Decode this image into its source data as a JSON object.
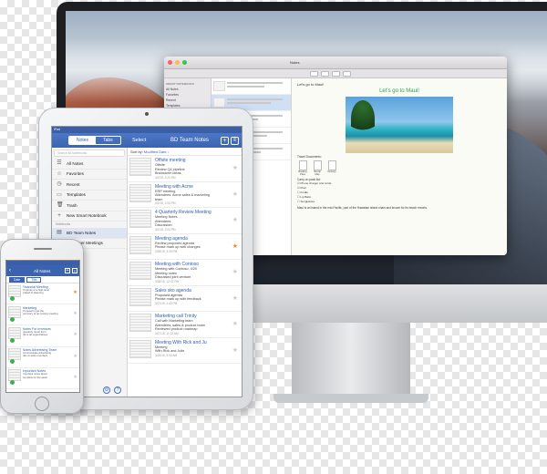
{
  "mac": {
    "window_title": "Notes",
    "sidebar": {
      "header_smart": "SMART NOTEBOOKS",
      "items": [
        "All Notes",
        "Favorites",
        "Recent",
        "Templates",
        "Trash"
      ],
      "header_notebooks": "NOTEBOOKS",
      "notebooks": [
        "Work",
        "Personal"
      ]
    },
    "note": {
      "subject": "Let's go to Maui!",
      "title": "Let's go to Maui!",
      "travel_label": "Travel Documents:",
      "docs": [
        "Booking Pass",
        "Rental Map",
        "Itinerary"
      ],
      "checklist_title": "Carry-on pack list:",
      "checklist": [
        "Phone charger and cords",
        "iPad",
        "Kindle",
        "Lip Balm",
        "Sunglasses"
      ],
      "footer": "Maui is an island in the mid-Pacific, part of the Hawaiian island chain and known for its beach resorts."
    }
  },
  "ipad": {
    "status_left": "iPad",
    "segment": [
      "Notes",
      "Tabs"
    ],
    "select_label": "Select",
    "notebook_title": "BD Team Notes",
    "plus_label": "+",
    "menu_label": "≡",
    "search_placeholder": "Search all Notebooks",
    "sidebar_items": [
      {
        "icon": "☰",
        "icon_name": "all-notes-icon",
        "label": "All Notes"
      },
      {
        "icon": "☆",
        "icon_name": "favorites-icon",
        "label": "Favorites"
      },
      {
        "icon": "◷",
        "icon_name": "recent-icon",
        "label": "Recent"
      },
      {
        "icon": "▭",
        "icon_name": "templates-icon",
        "label": "Templates"
      },
      {
        "icon": "🗑",
        "icon_name": "trash-icon",
        "label": "Trash"
      },
      {
        "icon": "+",
        "icon_name": "add-icon",
        "label": "New Smart Notebook"
      }
    ],
    "notebooks_header": "Notebooks",
    "notebooks": [
      {
        "label": "BD Team Notes",
        "selected": true
      },
      {
        "label": "Customer Meetings",
        "selected": false
      }
    ],
    "sort_label": "Sort by:",
    "sort_value": "Modified Date ↓",
    "notes": [
      {
        "title": "Offsite meeting",
        "lines": [
          "Offsite",
          "Review Q4 pipeline",
          "Brainstorm ideas"
        ],
        "date": "4/2/15, 2:20 PM",
        "starred": false
      },
      {
        "title": "Meeting with Acme",
        "lines": [
          "ERP meeting",
          "Attendees: Acme sales & marketing",
          "team"
        ],
        "date": "4/2/15, 1:53 PM",
        "starred": false
      },
      {
        "title": "4 Quarterly Review Meeting",
        "lines": [
          "Meeting Notes",
          "Attendees:",
          "Discussion:"
        ],
        "date": "4/2/15, 2:00 PM",
        "starred": false
      },
      {
        "title": "Meeting agenda",
        "lines": [
          "Review proposed agenda",
          "Please mark up with changes"
        ],
        "date": "3/28/15, 3:20 PM",
        "starred": true
      },
      {
        "title": "Meeting with Contoso",
        "lines": [
          "Meeting with Contoso, 4/20",
          "Meeting notes",
          "Discussed joint venture"
        ],
        "date": "3/28/15, 12:47 PM",
        "starred": false
      },
      {
        "title": "Sales sko agenda",
        "lines": [
          "Proposed agenda",
          "Please mark up with feedback"
        ],
        "date": "3/27/15, 4:43 PM",
        "starred": false
      },
      {
        "title": "Marketing call Trinity",
        "lines": [
          "Call with Marketing team",
          "Attendees: sales & product team",
          "Reviewed product roadmap"
        ],
        "date": "3/27/15, 11:12 AM",
        "starred": false
      },
      {
        "title": "Meeting  With Rick and Ju",
        "lines": [
          "Meeting",
          "With Rick and Julie"
        ],
        "date": "3/26/15, 9:00 AM",
        "starred": false
      }
    ],
    "footer_gear": "⚙",
    "footer_help": "?"
  },
  "iphone": {
    "back": "‹",
    "title": "All Notes",
    "plus": "+",
    "menu": "≡",
    "segments": [
      "Date",
      "Title"
    ],
    "notes": [
      {
        "title": "Financial Meeting",
        "lines": [
          "Progress of a high-level",
          "related to planning"
        ],
        "starred": true,
        "synced": true
      },
      {
        "title": "Marketing",
        "lines": [
          "Proposal to get the",
          "summary of up coming meeting"
        ],
        "starred": false,
        "synced": true
      },
      {
        "title": "Notes For Investors",
        "lines": [
          "Quarterly report from",
          "Q2 to all organizations"
        ],
        "starred": false,
        "synced": true
      },
      {
        "title": "Notes Advertising Team",
        "lines": [
          "Communicate advertising",
          "plan to team members"
        ],
        "starred": false,
        "synced": true
      },
      {
        "title": "Important Notes",
        "lines": [
          "Important notes about",
          "the plans for the week"
        ],
        "starred": false,
        "synced": true
      }
    ],
    "hidden_sidebar_fragments": [
      "ngs",
      "nt Guides",
      "Team",
      "ly Status"
    ]
  }
}
